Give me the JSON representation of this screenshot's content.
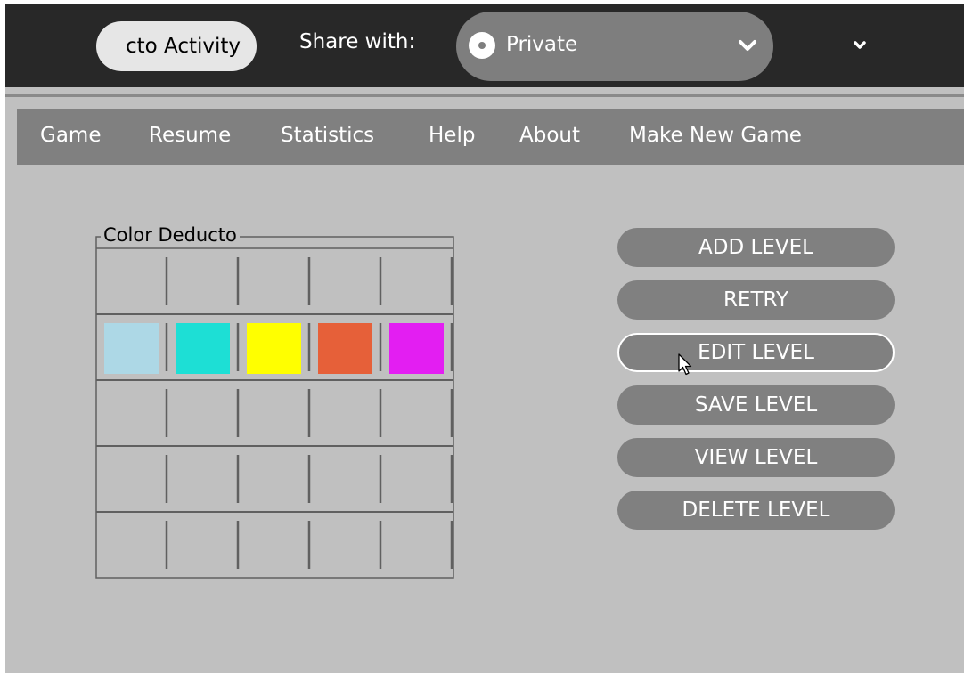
{
  "toolbar": {
    "activity_name": "cto Activity",
    "share_label": "Share with:",
    "share_value": "Private",
    "share_icon": "radio-dot-icon",
    "share_chevron_icon": "chevron-down-icon",
    "overflow_icon": "chevron-down-icon"
  },
  "menu": {
    "items": [
      {
        "label": "Game"
      },
      {
        "label": "Resume"
      },
      {
        "label": "Statistics"
      },
      {
        "label": "Help"
      },
      {
        "label": "About"
      },
      {
        "label": "Make New Game"
      }
    ]
  },
  "board": {
    "title": "Color Deducto",
    "rows": 5,
    "columns": 5,
    "filled_row": 2,
    "colors": [
      "#add8e6",
      "#1ddfd5",
      "#ffff00",
      "#e66039",
      "#e31ef2"
    ]
  },
  "actions": {
    "buttons": [
      {
        "label": "ADD LEVEL"
      },
      {
        "label": "RETRY"
      },
      {
        "label": "EDIT LEVEL"
      },
      {
        "label": "SAVE LEVEL"
      },
      {
        "label": "VIEW LEVEL"
      },
      {
        "label": "DELETE LEVEL"
      }
    ],
    "focused": "EDIT LEVEL"
  },
  "theme": {
    "toolbar_bg": "#282828",
    "canvas_bg": "#c0c0c0",
    "menubar_bg": "#808080",
    "button_bg": "#808080",
    "text_light": "#ffffff"
  }
}
